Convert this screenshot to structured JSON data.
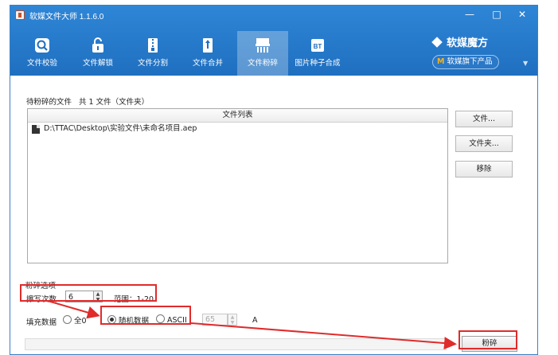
{
  "window": {
    "title": "软媒文件大师 1.1.6.0",
    "minimize": "—",
    "maximize": "□",
    "close": "✕"
  },
  "tabs": [
    {
      "label": "文件校验",
      "icon": "magnifier-icon"
    },
    {
      "label": "文件解锁",
      "icon": "unlock-icon"
    },
    {
      "label": "文件分割",
      "icon": "zip-split-icon"
    },
    {
      "label": "文件合并",
      "icon": "zip-merge-icon"
    },
    {
      "label": "文件粉碎",
      "icon": "shredder-icon"
    },
    {
      "label": "图片种子合成",
      "icon": "bt-icon"
    }
  ],
  "brand": {
    "name": "软媒魔方",
    "sub": "软媒旗下产品",
    "sub_mark": "M"
  },
  "content": {
    "pending_label": "待粉碎的文件",
    "pending_count": "共 1 文件（文件夹）",
    "list_header": "文件列表",
    "files": [
      "D:\\TTAC\\Desktop\\实验文件\\未命名项目.aep"
    ],
    "buttons": {
      "file": "文件...",
      "folder": "文件夹...",
      "remove": "移除"
    },
    "options_label": "粉碎选项",
    "overwrite_label": "擦写次数",
    "overwrite_value": "6",
    "range_label": "范围：1-20",
    "fill_label": "填充数据",
    "fill_options": {
      "zero": "全0",
      "random": "随机数据",
      "ascii": "ASCII"
    },
    "ascii_value": "65",
    "ascii_char": "A",
    "shred_button": "粉碎"
  },
  "colors": {
    "titlebar": "#2a7ccc",
    "highlight": "#e02b2b"
  }
}
